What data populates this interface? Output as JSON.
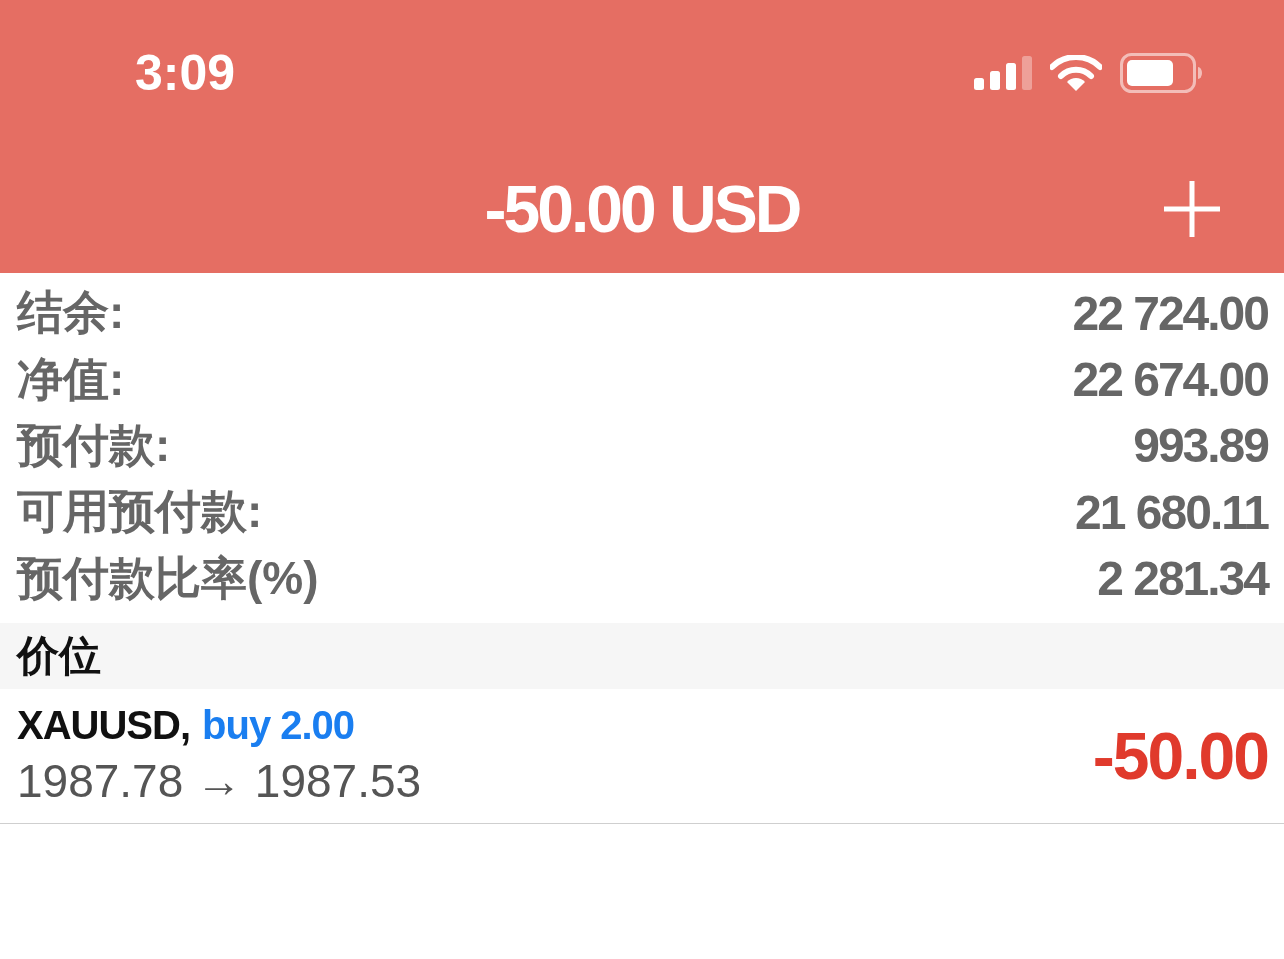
{
  "status_bar": {
    "time": "3:09"
  },
  "header": {
    "title": "-50.00 USD"
  },
  "account": [
    {
      "label": "结余:",
      "value": "22 724.00"
    },
    {
      "label": "净值:",
      "value": "22 674.00"
    },
    {
      "label": "预付款:",
      "value": "993.89"
    },
    {
      "label": "可用预付款:",
      "value": "21 680.11"
    },
    {
      "label": "预付款比率(%)",
      "value": "2 281.34"
    }
  ],
  "positions_section": {
    "title": "价位"
  },
  "positions": [
    {
      "symbol": "XAUUSD,",
      "direction": "buy 2.00",
      "prices": "1987.78 → 1987.53",
      "profit": "-50.00"
    }
  ]
}
